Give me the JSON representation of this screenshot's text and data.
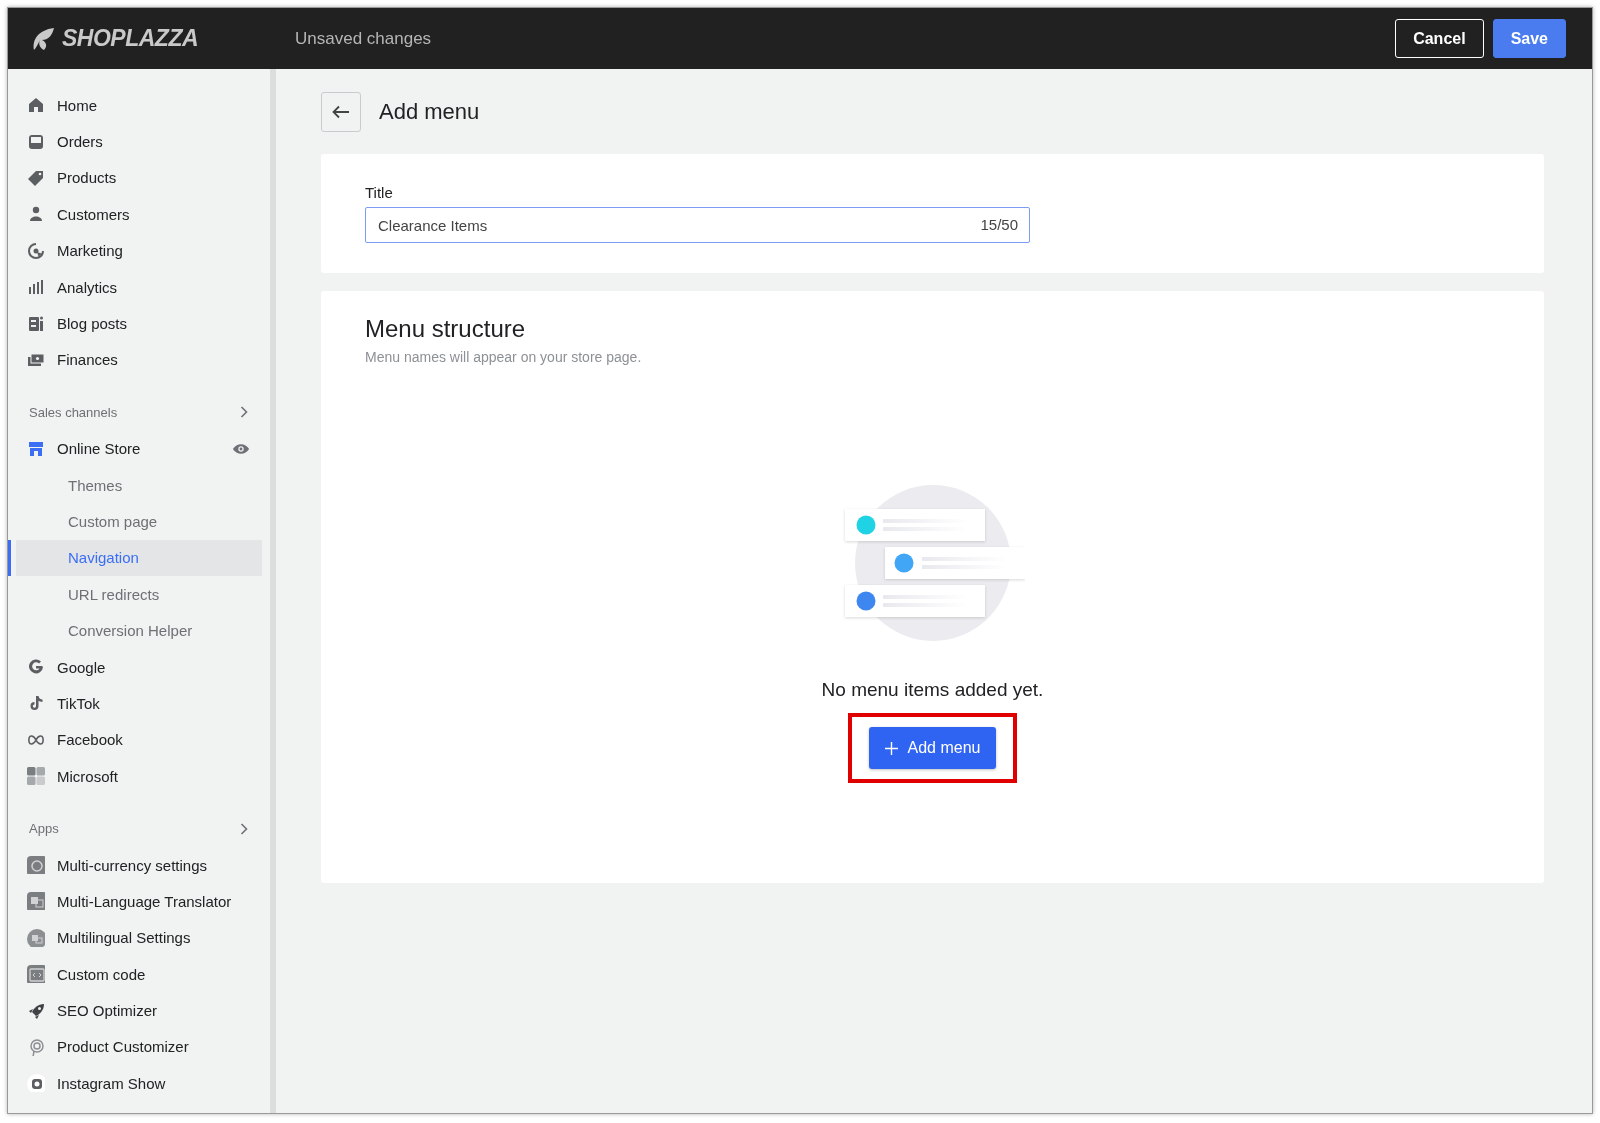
{
  "header": {
    "logo": "SHOPLAZZA",
    "status": "Unsaved changes",
    "buttons": [
      {
        "label": "Cancel",
        "kind": "secondary"
      },
      {
        "label": "Save",
        "kind": "primary"
      }
    ]
  },
  "sidebar": {
    "items": [
      {
        "label": "Home",
        "selected": false
      },
      {
        "label": "Orders",
        "selected": false
      },
      {
        "label": "Products",
        "selected": false
      },
      {
        "label": "Customers",
        "selected": false
      },
      {
        "label": "Marketing",
        "selected": false
      },
      {
        "label": "Analytics",
        "selected": false
      },
      {
        "label": "Blog posts",
        "selected": false
      },
      {
        "label": "Finances",
        "selected": false
      }
    ],
    "sections": [
      {
        "title": "Sales channels",
        "items": [
          {
            "label": "Online Store",
            "selected": false,
            "children": [
              {
                "label": "Themes",
                "selected": false
              },
              {
                "label": "Custom page",
                "selected": false
              },
              {
                "label": "Navigation",
                "selected": true
              },
              {
                "label": "URL redirects",
                "selected": false
              },
              {
                "label": "Conversion Helper",
                "selected": false
              }
            ]
          },
          {
            "label": "Google",
            "selected": false
          },
          {
            "label": "TikTok",
            "selected": false
          },
          {
            "label": "Facebook",
            "selected": false
          },
          {
            "label": "Microsoft",
            "selected": false
          }
        ]
      },
      {
        "title": "Apps",
        "items": [
          {
            "label": "Multi-currency settings",
            "selected": false
          },
          {
            "label": "Multi-Language Translator",
            "selected": false
          },
          {
            "label": "Multilingual Settings",
            "selected": false
          },
          {
            "label": "Custom code",
            "selected": false
          },
          {
            "label": "SEO Optimizer",
            "selected": false
          },
          {
            "label": "Product Customizer",
            "selected": false
          },
          {
            "label": "Instagram Show",
            "selected": false
          }
        ]
      }
    ]
  },
  "page": {
    "title": "Add menu",
    "title_field": {
      "label": "Title",
      "value": "Clearance Items",
      "counter": "15/50"
    },
    "structure": {
      "title": "Menu structure",
      "subtitle": "Menu names will appear on your store page.",
      "empty_text": "No menu items added yet.",
      "add_button": {
        "label": "Add menu",
        "highlighted": true
      }
    }
  }
}
